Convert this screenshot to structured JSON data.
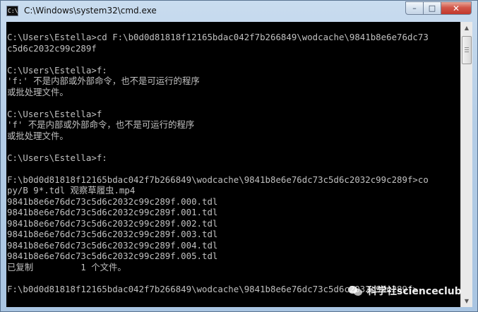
{
  "window": {
    "title": "C:\\Windows\\system32\\cmd.exe",
    "icon_text": "C:\\",
    "buttons": {
      "minimize": "–",
      "maximize": "□",
      "close": "✕"
    }
  },
  "console": {
    "lines": [
      "C:\\Users\\Estella>cd F:\\b0d0d81818f12165bdac042f7b266849\\wodcache\\9841b8e6e76dc73",
      "c5d6c2032c99c289f",
      "",
      "C:\\Users\\Estella>f:",
      "'f:' 不是内部或外部命令，也不是可运行的程序",
      "或批处理文件。",
      "",
      "C:\\Users\\Estella>f",
      "'f' 不是内部或外部命令，也不是可运行的程序",
      "或批处理文件。",
      "",
      "C:\\Users\\Estella>f:",
      "",
      "F:\\b0d0d81818f12165bdac042f7b266849\\wodcache\\9841b8e6e76dc73c5d6c2032c99c289f>co",
      "py/B 9*.tdl 观察草履虫.mp4",
      "9841b8e6e76dc73c5d6c2032c99c289f.000.tdl",
      "9841b8e6e76dc73c5d6c2032c99c289f.001.tdl",
      "9841b8e6e76dc73c5d6c2032c99c289f.002.tdl",
      "9841b8e6e76dc73c5d6c2032c99c289f.003.tdl",
      "9841b8e6e76dc73c5d6c2032c99c289f.004.tdl",
      "9841b8e6e76dc73c5d6c2032c99c289f.005.tdl",
      "已复制         1 个文件。",
      "",
      "F:\\b0d0d81818f12165bdac042f7b266849\\wodcache\\9841b8e6e76dc73c5d6c2032c99c289f>"
    ]
  },
  "scrollbar": {
    "up_arrow": "▲",
    "down_arrow": "▼"
  },
  "watermark": {
    "text": "科学社scienceclub"
  }
}
